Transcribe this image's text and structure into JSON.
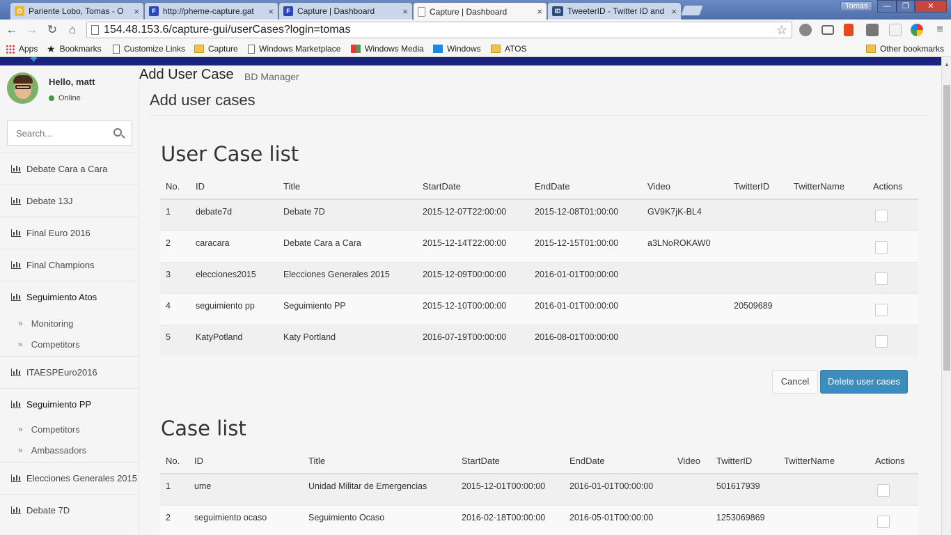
{
  "browser": {
    "tabs": [
      {
        "title": "Pariente Lobo, Tomas - O",
        "icon_color": "#e8b63c",
        "icon_glyph": "O"
      },
      {
        "title": "http://pheme-capture.gat",
        "icon_color": "#2a47b8",
        "icon_glyph": "F"
      },
      {
        "title": "Capture | Dashboard",
        "icon_color": "#2a47b8",
        "icon_glyph": "F"
      },
      {
        "title": "Capture | Dashboard",
        "icon_color": "#ffffff",
        "icon_glyph": ""
      },
      {
        "title": "TweeterID - Twitter ID and",
        "icon_color": "#2b4d7e",
        "icon_glyph": "ID"
      }
    ],
    "tab_close": "×",
    "profile_name": "Tomas",
    "window_buttons": {
      "minimize": "—",
      "maximize": "❐",
      "close": "✕"
    },
    "nav": {
      "back": "←",
      "forward": "→",
      "reload": "↻",
      "home": "⌂"
    },
    "url": "154.48.153.6/capture-gui/userCases?login=tomas",
    "star": "☆",
    "bookmarks": [
      {
        "label": "Apps",
        "icon": "apps-grid-icon"
      },
      {
        "label": "Bookmarks",
        "icon": "star-icon"
      },
      {
        "label": "Customize Links",
        "icon": "page-icon"
      },
      {
        "label": "Capture",
        "icon": "folder-icon"
      },
      {
        "label": "Windows Marketplace",
        "icon": "page-icon"
      },
      {
        "label": "Windows Media",
        "icon": "windows-flag-icon"
      },
      {
        "label": "Windows",
        "icon": "windows-icon"
      },
      {
        "label": "ATOS",
        "icon": "folder-icon"
      }
    ],
    "other_bookmarks": "Other bookmarks"
  },
  "sidebar": {
    "greeting": "Hello, matt",
    "status": "Online",
    "search_placeholder": "Search...",
    "items": [
      {
        "label": "Debate Cara a Cara"
      },
      {
        "label": "Debate 13J"
      },
      {
        "label": "Final Euro 2016"
      },
      {
        "label": "Final Champions"
      },
      {
        "label": "Seguimiento Atos"
      },
      {
        "label": "ITAESPEuro2016"
      },
      {
        "label": "Seguimiento PP"
      },
      {
        "label": "Elecciones Generales 2015"
      },
      {
        "label": "Debate 7D"
      }
    ],
    "subitems_atos": [
      {
        "label": "Monitoring"
      },
      {
        "label": "Competitors"
      }
    ],
    "subitems_pp": [
      {
        "label": "Competitors"
      },
      {
        "label": "Ambassadors"
      }
    ],
    "chevron": "»"
  },
  "header": {
    "title": "Add User Case",
    "subtitle": "BD Manager"
  },
  "main": {
    "box_title": "Add user cases",
    "user_case_list": {
      "title": "User Case list",
      "columns": [
        "No.",
        "ID",
        "Title",
        "StartDate",
        "EndDate",
        "Video",
        "TwitterID",
        "TwitterName",
        "Actions"
      ],
      "rows": [
        [
          "1",
          "debate7d",
          "Debate 7D",
          "2015-12-07T22:00:00",
          "2015-12-08T01:00:00",
          "GV9K7jK-BL4",
          "",
          ""
        ],
        [
          "2",
          "caracara",
          "Debate Cara a Cara",
          "2015-12-14T22:00:00",
          "2015-12-15T01:00:00",
          "a3LNoROKAW0",
          "",
          ""
        ],
        [
          "3",
          "elecciones2015",
          "Elecciones Generales 2015",
          "2015-12-09T00:00:00",
          "2016-01-01T00:00:00",
          "",
          "",
          ""
        ],
        [
          "4",
          "seguimiento pp",
          "Seguimiento PP",
          "2015-12-10T00:00:00",
          "2016-01-01T00:00:00",
          "",
          "20509689",
          ""
        ],
        [
          "5",
          "KatyPotland",
          "Katy Portland",
          "2016-07-19T00:00:00",
          "2016-08-01T00:00:00",
          "",
          "",
          ""
        ]
      ]
    },
    "buttons": {
      "cancel": "Cancel",
      "delete": "Delete user cases"
    },
    "case_list": {
      "title": "Case list",
      "columns": [
        "No.",
        "ID",
        "Title",
        "StartDate",
        "EndDate",
        "Video",
        "TwitterID",
        "TwitterName",
        "Actions"
      ],
      "rows": [
        [
          "1",
          "ume",
          "Unidad Militar de Emergencias",
          "2015-12-01T00:00:00",
          "2016-01-01T00:00:00",
          "",
          "501617939",
          ""
        ],
        [
          "2",
          "seguimiento ocaso",
          "Seguimiento Ocaso",
          "2016-02-18T00:00:00",
          "2016-05-01T00:00:00",
          "",
          "1253069869",
          ""
        ]
      ]
    }
  },
  "colors": {
    "accent": "#3c8dbc",
    "topbar": "#1a237e",
    "online": "#3c9a3c"
  }
}
